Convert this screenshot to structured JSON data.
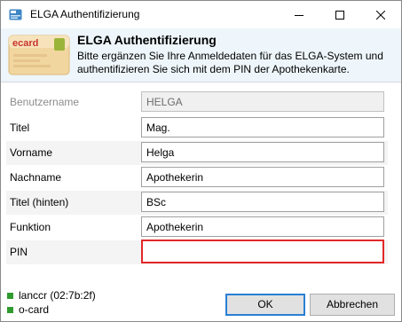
{
  "window": {
    "title": "ELGA Authentifizierung"
  },
  "header": {
    "title": "ELGA Authentifizierung",
    "description": "Bitte ergänzen Sie Ihre Anmeldedaten für das ELGA-System und authentifizieren Sie sich mit dem PIN der Apothekenkarte.",
    "card_brand": "ecard"
  },
  "form": {
    "username_label": "Benutzername",
    "username_value": "HELGA",
    "title_label": "Titel",
    "title_value": "Mag.",
    "firstname_label": "Vorname",
    "firstname_value": "Helga",
    "lastname_label": "Nachname",
    "lastname_value": "Apothekerin",
    "title_after_label": "Titel (hinten)",
    "title_after_value": "BSc",
    "function_label": "Funktion",
    "function_value": "Apothekerin",
    "pin_label": "PIN",
    "pin_value": ""
  },
  "status": [
    {
      "text": "lanccr (02:7b:2f)",
      "color": "#2f9b2f"
    },
    {
      "text": "o-card",
      "color": "#2f9b2f"
    }
  ],
  "buttons": {
    "ok": "OK",
    "cancel": "Abbrechen"
  },
  "colors": {
    "header_bg": "#eef6fb",
    "error_border": "#e22828",
    "accent": "#2a7fd4"
  }
}
